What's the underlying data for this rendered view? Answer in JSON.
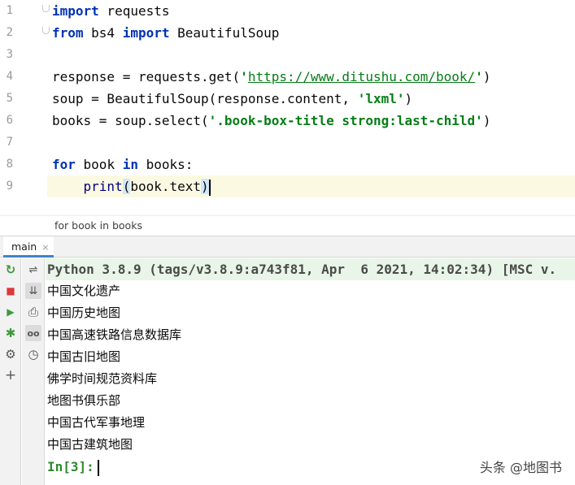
{
  "editor": {
    "line_numbers": [
      "1",
      "2",
      "3",
      "4",
      "5",
      "6",
      "7",
      "8",
      "9"
    ],
    "lines": {
      "l1": {
        "kw1": "import",
        "rest": " requests"
      },
      "l2": {
        "kw1": "from",
        "mid": " bs4 ",
        "kw2": "import",
        "rest": " BeautifulSoup"
      },
      "l4": {
        "pre": "response = requests.get(",
        "q1": "'",
        "url": "https://www.ditushu.com/book/",
        "q2": "'",
        "post": ")"
      },
      "l5": {
        "pre": "soup = BeautifulSoup(response.content, ",
        "str": "'lxml'",
        "post": ")"
      },
      "l6": {
        "pre": "books = soup.select(",
        "str": "'.book-box-title strong:last-child'",
        "post": ")"
      },
      "l8": {
        "kw1": "for",
        "mid": " book ",
        "kw2": "in",
        "rest": " books:"
      },
      "l9": {
        "indent": "    ",
        "fn": "print",
        "open": "(",
        "arg": "book.text",
        "close": ")"
      }
    }
  },
  "breadcrumb": "for book in books",
  "tool_window": {
    "tab_label": "main",
    "tab_close": "×"
  },
  "console": {
    "header": "Python 3.8.9 (tags/v3.8.9:a743f81, Apr  6 2021, 14:02:34) [MSC v.",
    "output_lines": [
      "中国文化遗产",
      "中国历史地图",
      "中国高速铁路信息数据库",
      "中国古旧地图",
      "佛学时间规范资料库",
      "地图书俱乐部",
      "中国古代军事地理",
      "中国古建筑地图"
    ],
    "prompt": "In[3]:"
  },
  "toolbar_icons": {
    "rerun": "↻",
    "stop": "■",
    "run": "▶",
    "debug": "✱",
    "settings": "⚙",
    "add": "+",
    "soft_wrap": "⇌",
    "scroll_end": "⇊",
    "print": "⎙",
    "variables": "oo",
    "history": "◷"
  },
  "watermark": "头条 @地图书",
  "colors": {
    "keyword": "#0033b3",
    "string": "#067d17",
    "prompt": "#2c8a2c",
    "rerun_green": "#3c9a3c",
    "stop_red": "#db3b3b",
    "tab_underline": "#4083c9"
  }
}
